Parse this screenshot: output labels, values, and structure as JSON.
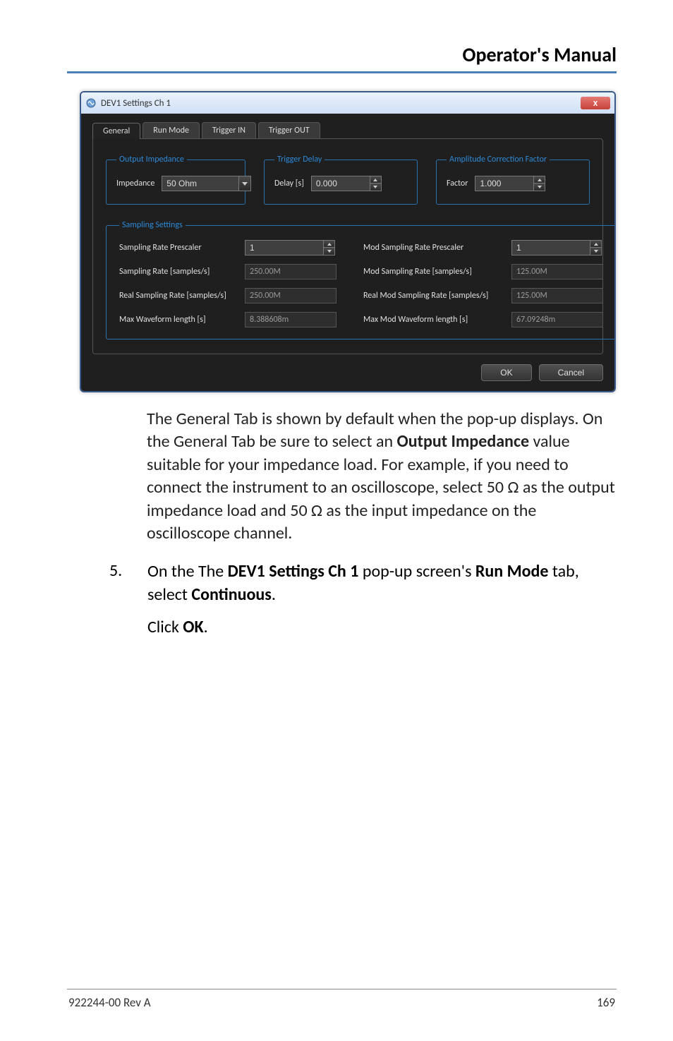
{
  "header": {
    "title": "Operator's Manual"
  },
  "dialog": {
    "title": "DEV1 Settings Ch 1",
    "close": "X",
    "tabs": [
      "General",
      "Run Mode",
      "Trigger IN",
      "Trigger OUT"
    ],
    "activeTab": "General",
    "outputImpedance": {
      "legend": "Output Impedance",
      "impedanceLabel": "Impedance",
      "impedanceValue": "50 Ohm"
    },
    "triggerDelay": {
      "legend": "Trigger Delay",
      "delayLabel": "Delay [s]",
      "delayValue": "0.000"
    },
    "amplitudeCorrection": {
      "legend": "Amplitude Correction Factor",
      "factorLabel": "Factor",
      "factorValue": "1.000"
    },
    "sampling": {
      "legend": "Sampling Settings",
      "rows": {
        "r1l": "Sampling Rate Prescaler",
        "r1v": "1",
        "r1l2": "Mod Sampling Rate Prescaler",
        "r1v2": "1",
        "r2l": "Sampling Rate [samples/s]",
        "r2v": "250.00M",
        "r2l2": "Mod Sampling Rate [samples/s]",
        "r2v2": "125.00M",
        "r3l": "Real Sampling Rate [samples/s]",
        "r3v": "250.00M",
        "r3l2": "Real Mod Sampling Rate [samples/s]",
        "r3v2": "125.00M",
        "r4l": "Max Waveform length [s]",
        "r4v": "8.388608m",
        "r4l2": "Max Mod Waveform length [s]",
        "r4v2": "67.09248m"
      }
    },
    "buttons": {
      "ok": "OK",
      "cancel": "Cancel"
    }
  },
  "text": {
    "para1_a": "The General Tab is shown by default when the pop-up displays. On the General Tab be sure to select an ",
    "para1_b": "Output Impedance",
    "para1_c": " value suitable for your impedance load. For example, if you need to connect the instrument to an oscilloscope, select 50 Ω as the output impedance load and 50 Ω as the input impedance on the oscilloscope channel.",
    "step5_num": "5.",
    "step5_a": "On the The ",
    "step5_b": "DEV1 Settings Ch 1",
    "step5_c": " pop-up screen's ",
    "step5_d": "Run Mode",
    "step5_e": " tab, select ",
    "step5_f": "Continuous",
    "step5_g": ".",
    "step5_click_a": "Click ",
    "step5_click_b": "OK",
    "step5_click_c": "."
  },
  "footer": {
    "left": "922244-00 Rev A",
    "right": "169"
  }
}
